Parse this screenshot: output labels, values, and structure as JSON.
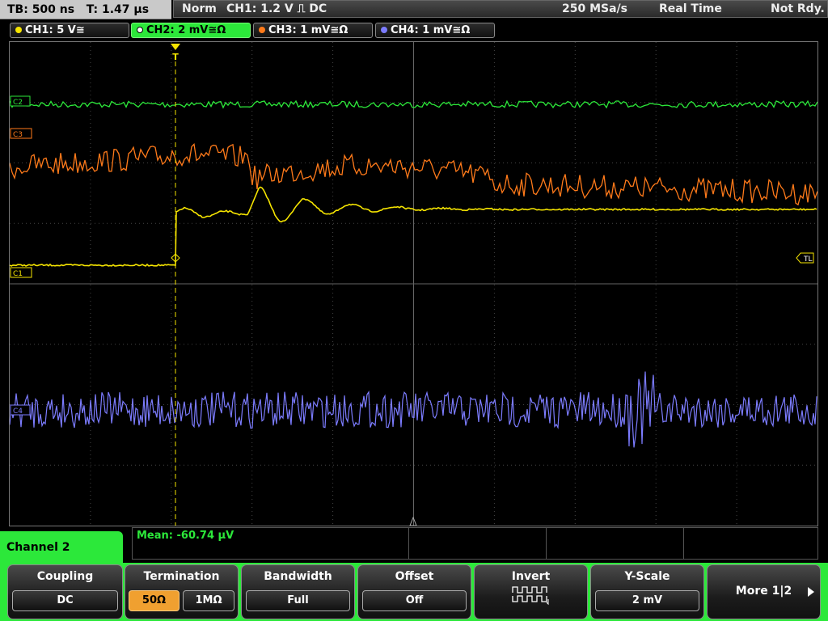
{
  "topbar": {
    "timebase": "TB: 500 ns   T: 1.47 µs",
    "trigger_mode": "Norm",
    "trigger_info": "CH1: 1.2 V ⎍ DC",
    "sample_rate": "250 MSa/s",
    "acquisition": "Real Time",
    "state": "Not Rdy."
  },
  "channels": [
    {
      "label": "CH1: 5 V≅",
      "color": "#f5e400"
    },
    {
      "label": "CH2: 2 mV≅Ω",
      "color": "#2ce83a"
    },
    {
      "label": "CH3: 1 mV≅Ω",
      "color": "#ff7a1a"
    },
    {
      "label": "CH4: 1 mV≅Ω",
      "color": "#7c7cff"
    }
  ],
  "markers": {
    "c1": "C1",
    "c2": "C2",
    "c3": "C3",
    "c4": "C4",
    "trigger_level": "TL",
    "trigger_pos": "T"
  },
  "measurement": {
    "label": "Mean: -60.74 µV"
  },
  "menu": {
    "active_channel": "Channel 2",
    "coupling": {
      "title": "Coupling",
      "value": "DC"
    },
    "termination": {
      "title": "Termination",
      "opt_a": "50Ω",
      "opt_b": "1MΩ"
    },
    "bandwidth": {
      "title": "Bandwidth",
      "value": "Full"
    },
    "offset": {
      "title": "Offset",
      "value": "Off"
    },
    "invert": {
      "title": "Invert",
      "icon": "square-wave-icon"
    },
    "yscale": {
      "title": "Y-Scale",
      "value": "2 mV"
    },
    "more": {
      "title": "More 1|2"
    }
  }
}
